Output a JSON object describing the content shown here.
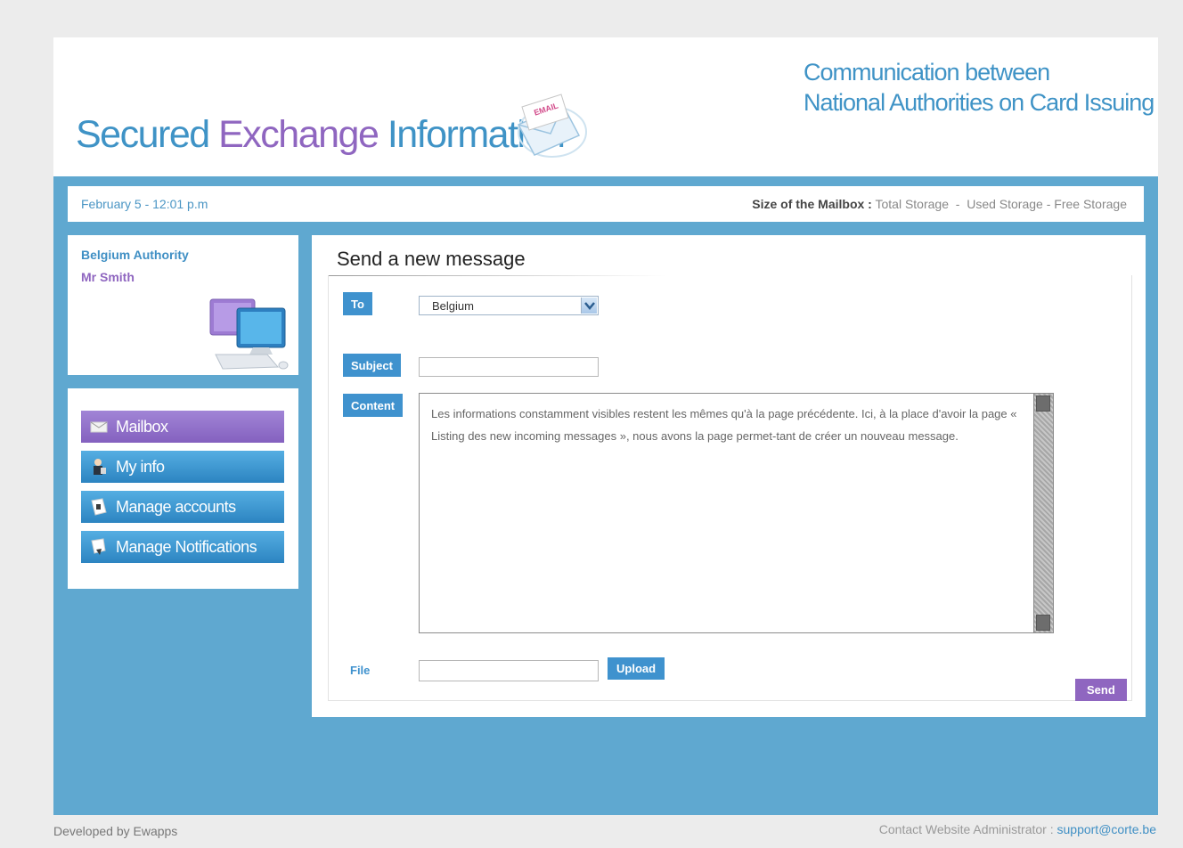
{
  "header": {
    "logo_part1": "Secured ",
    "logo_part2": "Exchange",
    "logo_part3": " Information",
    "envelope_label": "EMAIL",
    "tagline_line1": "Communication between",
    "tagline_line2": "National Authorities on Card Issuing"
  },
  "infobar": {
    "date": "February 5  -  12:01 p.m",
    "mailbox_label": "Size of the Mailbox :",
    "total_storage": "Total Storage",
    "sep1": "-",
    "used_storage": "Used Storage",
    "sep2": "-",
    "free_storage": "Free Storage"
  },
  "profile": {
    "authority": "Belgium Authority",
    "user": "Mr Smith"
  },
  "nav": {
    "items": [
      {
        "label": "Mailbox",
        "icon": "mail-icon"
      },
      {
        "label": "My info",
        "icon": "person-icon"
      },
      {
        "label": "Manage accounts",
        "icon": "accounts-icon"
      },
      {
        "label": "Manage Notifications",
        "icon": "notifications-icon"
      }
    ]
  },
  "form": {
    "title": "Send a new message",
    "to_label": "To",
    "to_value": "Belgium",
    "subject_label": "Subject",
    "subject_value": "",
    "content_label": "Content",
    "content_value": "Les informations constamment visibles restent les mêmes qu'à la page précédente. Ici, à la place d'avoir la page « Listing des new incoming messages », nous avons la page permet-tant de créer un nouveau message.",
    "file_label": "File",
    "file_value": "",
    "upload_label": "Upload",
    "send_label": "Send"
  },
  "footer": {
    "developed_by": "Developed by Ewapps",
    "contact_label": "Contact Website Administrator :",
    "contact_email": "support@corte.be"
  },
  "colors": {
    "blue": "#3f93c6",
    "purple": "#8f66c0",
    "page_bg": "#5fa8d0"
  }
}
